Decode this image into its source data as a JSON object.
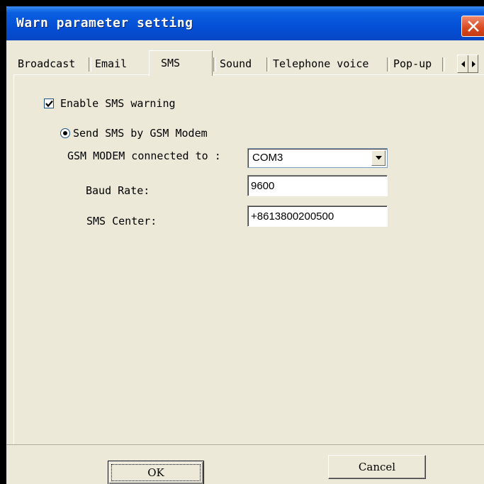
{
  "window": {
    "title": "Warn parameter setting"
  },
  "tabs": [
    {
      "label": "Broadcast"
    },
    {
      "label": "Email"
    },
    {
      "label": "SMS",
      "selected": true
    },
    {
      "label": "Sound"
    },
    {
      "label": "Telephone voice"
    },
    {
      "label": "Pop-up"
    }
  ],
  "sms": {
    "enable_label": "Enable SMS warning",
    "enable_checked": true,
    "gsm_option_label": "Send SMS by GSM Modem",
    "gsm_selected": true,
    "modem_label": "GSM MODEM connected to :",
    "modem_value": "COM3",
    "baud_label": "Baud Rate:",
    "baud_value": "9600",
    "center_label": "SMS Center:",
    "center_value": "+8613800200500"
  },
  "buttons": {
    "ok": "OK",
    "cancel": "Cancel"
  },
  "icons": {
    "close": "close-icon",
    "tab_left": "arrow-left-icon",
    "tab_right": "arrow-right-icon",
    "dropdown": "chevron-down-icon",
    "check": "check-icon"
  },
  "colors": {
    "titlebar": "#0550d6",
    "close_button": "#d8481f",
    "dialog_bg": "#ece9d8"
  }
}
